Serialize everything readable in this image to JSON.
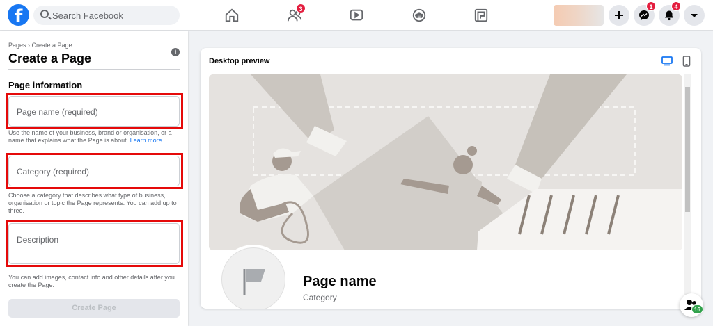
{
  "header": {
    "logo_letter": "f",
    "search_placeholder": "Search Facebook",
    "nav": [
      {
        "icon": "home-icon"
      },
      {
        "icon": "friends-icon",
        "badge": "3"
      },
      {
        "icon": "watch-icon"
      },
      {
        "icon": "groups-icon"
      },
      {
        "icon": "gaming-icon"
      }
    ],
    "messenger_badge": "1",
    "notifications_badge": "4"
  },
  "left": {
    "breadcrumb": "Pages › Create a Page",
    "title": "Create a Page",
    "section_title": "Page information",
    "page_name_placeholder": "Page name (required)",
    "page_name_help": "Use the name of your business, brand or organisation, or a name that explains what the Page is about.",
    "learn_more": "Learn more",
    "category_placeholder": "Category (required)",
    "category_help": "Choose a category that describes what type of business, organisation or topic the Page represents. You can add up to three.",
    "description_placeholder": "Description",
    "description_help": "You can add images, contact info and other details after you create the Page.",
    "create_button": "Create Page"
  },
  "preview": {
    "title": "Desktop preview",
    "page_name": "Page name",
    "category": "Category"
  },
  "contacts_badge": "16",
  "colors": {
    "brand": "#1877f2",
    "badge": "#e41e3f",
    "highlight": "#e50a0a"
  }
}
